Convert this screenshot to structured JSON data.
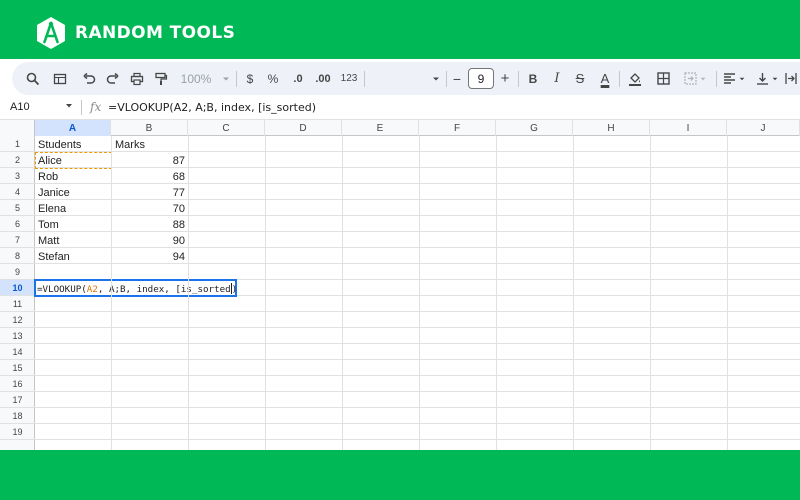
{
  "brand": {
    "name": "RANDOM TOOLS",
    "logo_icon": "hexagon-compass-logo",
    "band_color": "#00b956"
  },
  "toolbar": {
    "zoom": "100%",
    "currency": "$",
    "percent": "%",
    "decrease_decimal": ".0",
    "increase_decimal": ".00",
    "number_format": "123",
    "font_size": "9",
    "font_size_decrease": "−",
    "font_size_increase": "+",
    "bold": "B",
    "italic": "I",
    "strikethrough": "S",
    "text_color": "A"
  },
  "formula_bar": {
    "name_box": "A10",
    "fx": "fx",
    "formula": "=VLOOKUP(A2, A;B, index, [is_sorted)"
  },
  "sheet": {
    "columns": [
      "A",
      "B",
      "C",
      "D",
      "E",
      "F",
      "G",
      "H",
      "I",
      "J"
    ],
    "rows": [
      "1",
      "2",
      "3",
      "4",
      "5",
      "6",
      "7",
      "8",
      "9",
      "10",
      "11",
      "12",
      "13",
      "14",
      "15",
      "16",
      "17",
      "18",
      "19"
    ],
    "active_cell": "A10",
    "header": {
      "students": "Students",
      "marks": "Marks"
    },
    "data": [
      {
        "student": "Alice",
        "marks": "87"
      },
      {
        "student": "Rob",
        "marks": "68"
      },
      {
        "student": "Janice",
        "marks": "77"
      },
      {
        "student": "Elena",
        "marks": "70"
      },
      {
        "student": "Tom",
        "marks": "88"
      },
      {
        "student": "Matt",
        "marks": "90"
      },
      {
        "student": "Stefan",
        "marks": "94"
      }
    ],
    "editing_formula": {
      "prefix": "=VLOOKUP(",
      "ref": "A2",
      "suffix": ", A;B, index, [is_sorted",
      "close": ")"
    }
  }
}
